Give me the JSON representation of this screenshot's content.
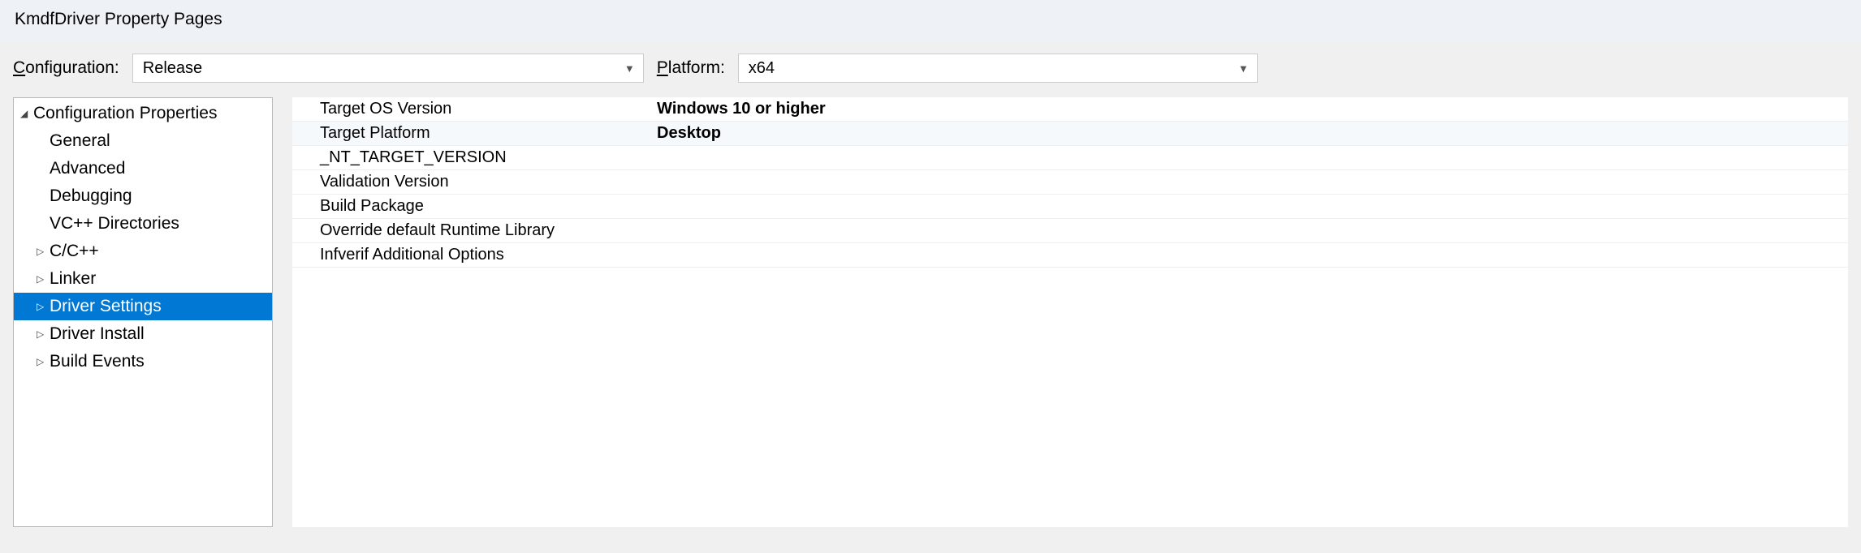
{
  "title": "KmdfDriver Property Pages",
  "configBar": {
    "configurationLabel": "Configuration:",
    "configurationValue": "Release",
    "platformLabel": "Platform:",
    "platformValue": "x64"
  },
  "tree": {
    "root": "Configuration Properties",
    "items": [
      {
        "label": "General",
        "expandable": false
      },
      {
        "label": "Advanced",
        "expandable": false
      },
      {
        "label": "Debugging",
        "expandable": false
      },
      {
        "label": "VC++ Directories",
        "expandable": false
      },
      {
        "label": "C/C++",
        "expandable": true
      },
      {
        "label": "Linker",
        "expandable": true
      },
      {
        "label": "Driver Settings",
        "expandable": true,
        "selected": true
      },
      {
        "label": "Driver Install",
        "expandable": true
      },
      {
        "label": "Build Events",
        "expandable": true
      }
    ]
  },
  "grid": {
    "rows": [
      {
        "label": "Target OS Version",
        "value": "Windows 10 or higher",
        "bold": true
      },
      {
        "label": "Target Platform",
        "value": "Desktop",
        "bold": true,
        "alt": true
      },
      {
        "label": "_NT_TARGET_VERSION",
        "value": ""
      },
      {
        "label": "Validation Version",
        "value": ""
      },
      {
        "label": "Build Package",
        "value": ""
      },
      {
        "label": "Override default Runtime Library",
        "value": ""
      },
      {
        "label": "Infverif Additional Options",
        "value": ""
      }
    ]
  }
}
